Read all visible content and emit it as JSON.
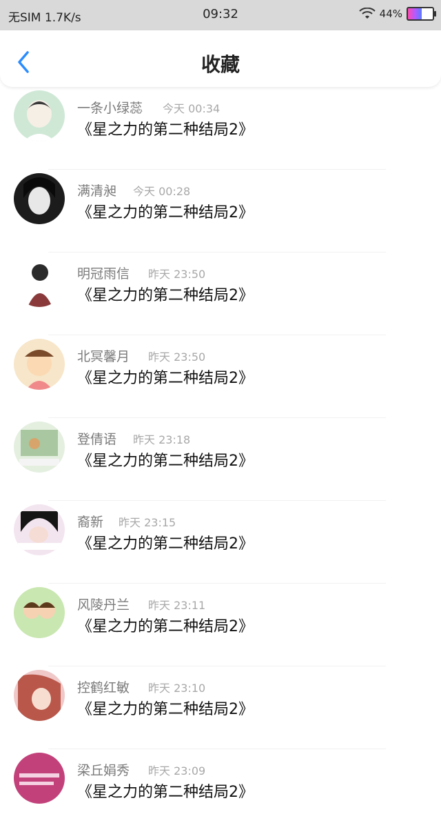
{
  "status_bar": {
    "carrier": "无SIM",
    "speed": "1.7K/s",
    "time": "09:32",
    "battery": "44%"
  },
  "nav": {
    "title": "收藏",
    "back_icon": "chevron-left-icon"
  },
  "colors": {
    "accent": "#2a8cff",
    "name_text": "#7a7a7a",
    "time_text": "#a8a8a8"
  },
  "items": [
    {
      "name": "一条小绿蕊",
      "time": "今天 00:34",
      "title": "《星之力的第二种结局2》"
    },
    {
      "name": "满清昶",
      "time": "今天 00:28",
      "title": "《星之力的第二种结局2》"
    },
    {
      "name": "明冠雨信",
      "time": "昨天 23:50",
      "title": "《星之力的第二种结局2》"
    },
    {
      "name": "北冥馨月",
      "time": "昨天 23:50",
      "title": "《星之力的第二种结局2》"
    },
    {
      "name": "登倩语",
      "time": "昨天 23:18",
      "title": "《星之力的第二种结局2》"
    },
    {
      "name": "裔新",
      "time": "昨天 23:15",
      "title": "《星之力的第二种结局2》"
    },
    {
      "name": "风陵丹兰",
      "time": "昨天 23:11",
      "title": "《星之力的第二种结局2》"
    },
    {
      "name": "控鹤红敏",
      "time": "昨天 23:10",
      "title": "《星之力的第二种结局2》"
    },
    {
      "name": "梁丘娟秀",
      "time": "昨天 23:09",
      "title": "《星之力的第二种结局2》"
    }
  ]
}
